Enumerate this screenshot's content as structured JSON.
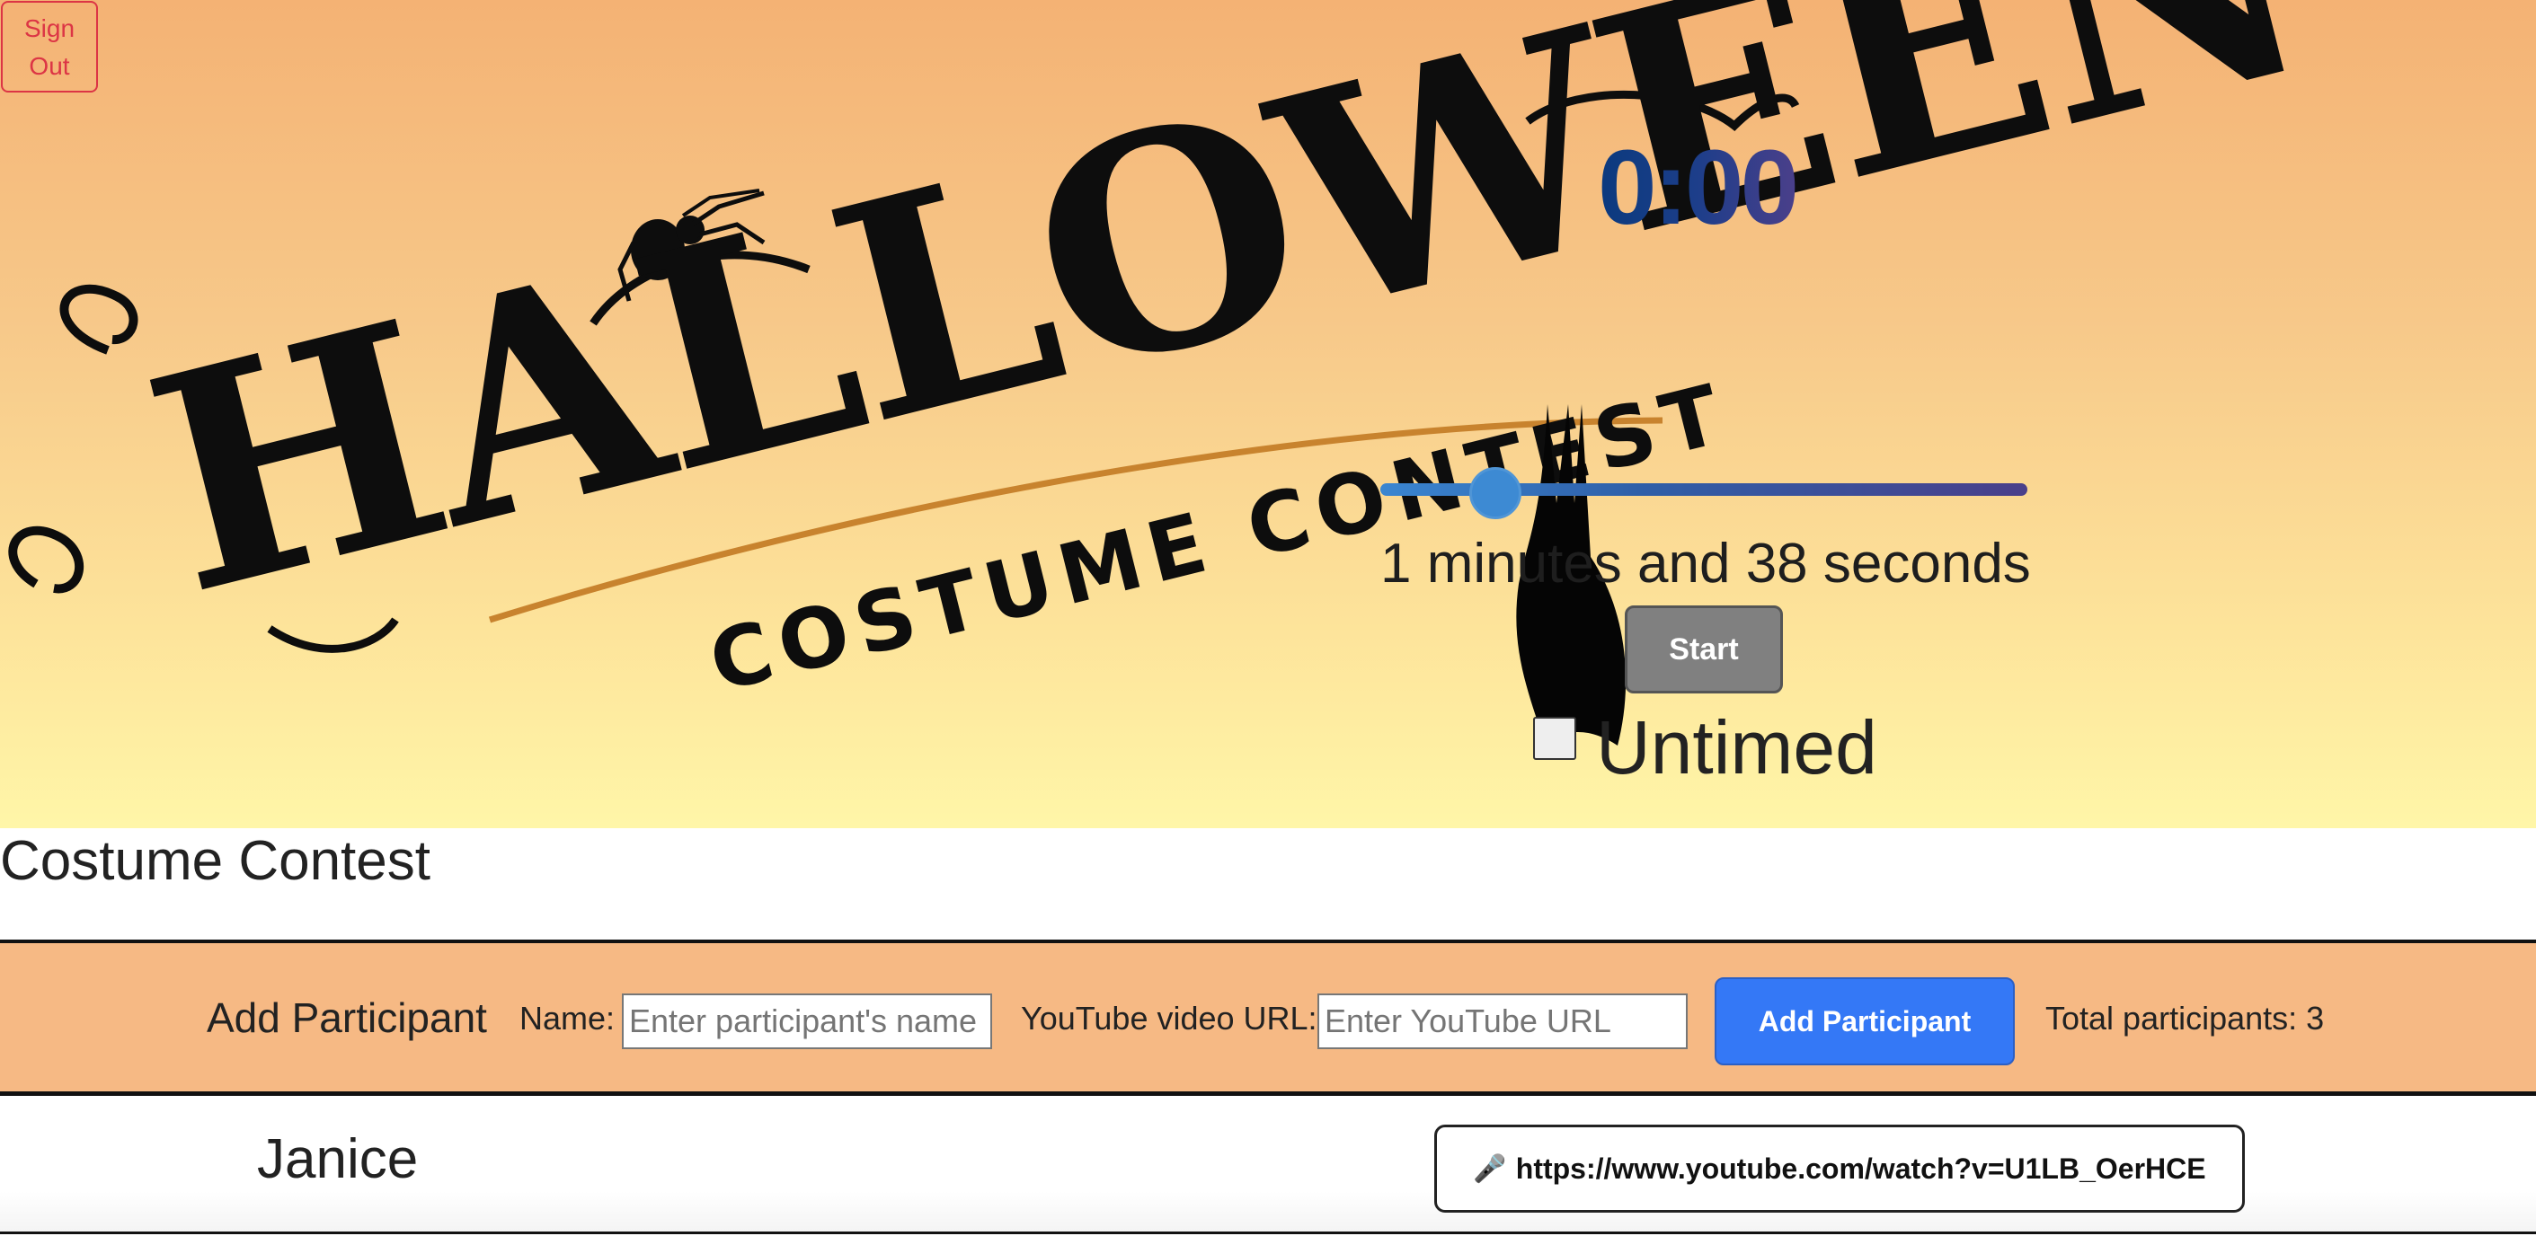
{
  "header": {
    "sign_out_label": "Sign Out",
    "logo": {
      "title": "HALLOWEEN",
      "subtitle": "COSTUME CONTEST"
    }
  },
  "timer": {
    "display": "0:00",
    "slider_value_fraction": 0.15,
    "duration_label": "1 minutes and 38 seconds",
    "start_label": "Start",
    "untimed_label": "Untimed",
    "untimed_checked": false
  },
  "main": {
    "title": "Costume Contest"
  },
  "add_participant": {
    "heading": "Add Participant",
    "name_label": "Name:",
    "name_placeholder": "Enter participant's name",
    "name_value": "",
    "url_label": "YouTube video URL:",
    "url_placeholder": "Enter YouTube URL",
    "url_value": "",
    "button_label": "Add Participant",
    "total_text": "Total participants: 3"
  },
  "participants": [
    {
      "name": "Janice",
      "icon": "microphone-icon",
      "url": "https://www.youtube.com/watch?v=U1LB_OerHCE"
    }
  ],
  "colors": {
    "sign_out": "#dc3545",
    "primary_button": "#3478f6",
    "start_button": "#808080",
    "add_bar": "#f6b984",
    "logo_ink": "#0d0d0d",
    "logo_accent": "#c8832e"
  }
}
